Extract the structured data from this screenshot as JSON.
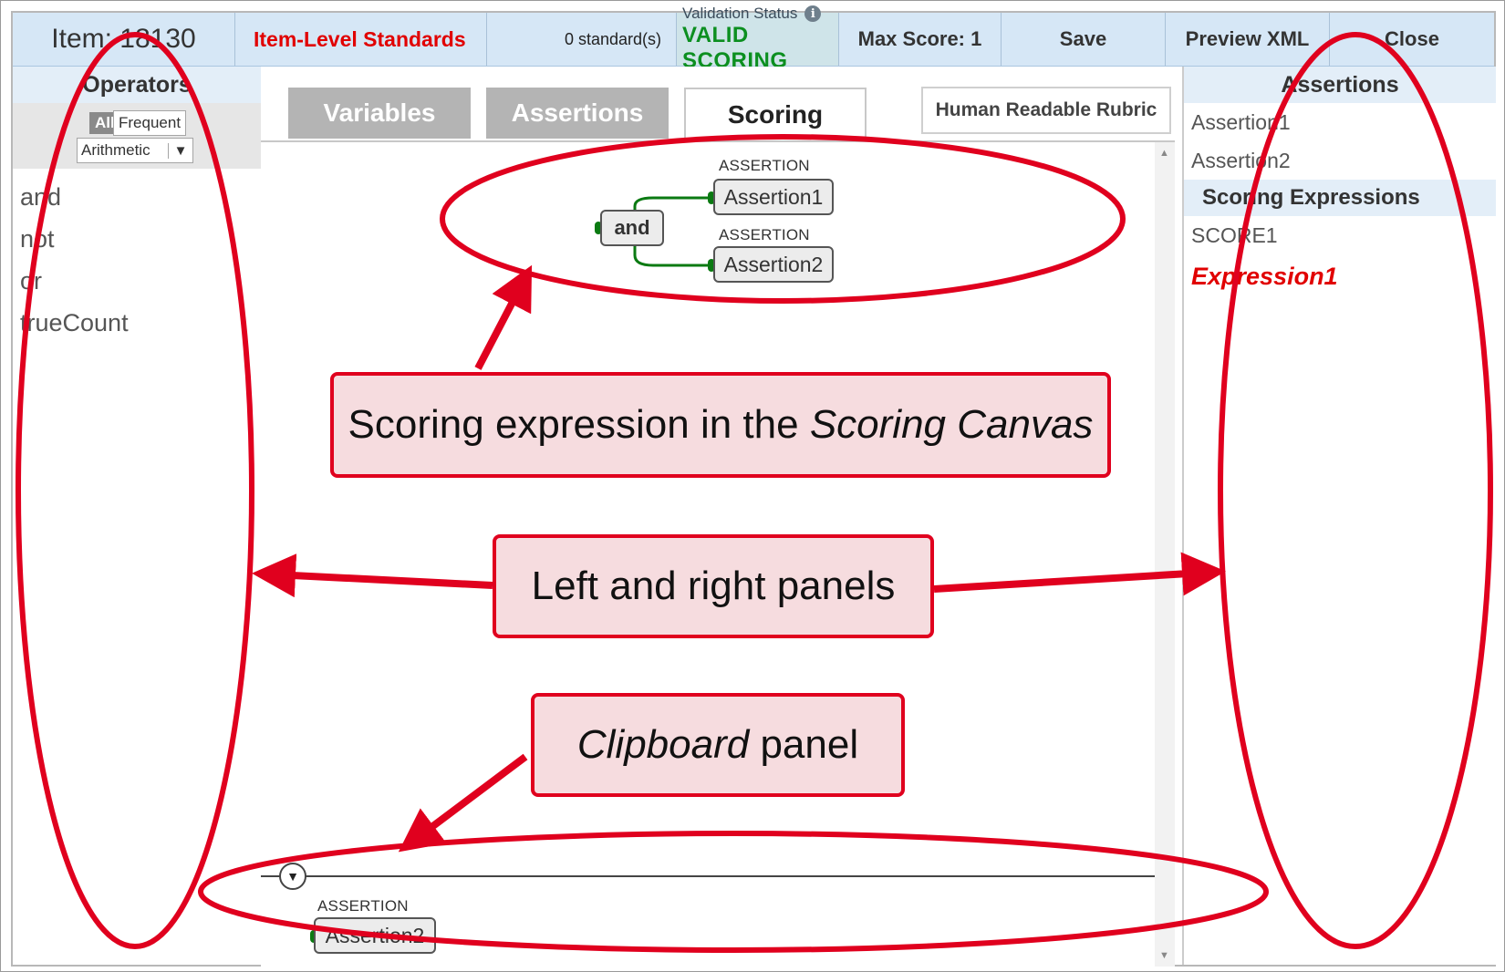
{
  "topbar": {
    "item_label": "Item: 18130",
    "standards_label": "Item-Level Standards",
    "standards_count": "0 standard(s)",
    "validation_label": "Validation Status",
    "validation_value": "VALID SCORING",
    "max_score": "Max Score: 1",
    "save": "Save",
    "preview_xml": "Preview XML",
    "close": "Close"
  },
  "left_panel": {
    "title": "Operators",
    "filter_all": "All",
    "filter_frequent": "Frequent",
    "category_select": "Arithmetic",
    "operators": [
      "and",
      "not",
      "or",
      "trueCount"
    ]
  },
  "tabs": {
    "variables": "Variables",
    "assertions": "Assertions",
    "scoring": "Scoring",
    "rubric_button": "Human Readable Rubric"
  },
  "canvas": {
    "operator_node": "and",
    "node_type": "ASSERTION",
    "node_1": "Assertion1",
    "node_2": "Assertion2",
    "clipboard_type": "ASSERTION",
    "clipboard_node": "Assertion2"
  },
  "right_panel": {
    "title": "Assertions",
    "assertions": [
      "Assertion1",
      "Assertion2"
    ],
    "section_title": "Scoring Expressions",
    "score_item": "SCORE1",
    "expression_item": "Expression1"
  },
  "annotations": {
    "box1_prefix": "Scoring expression in the ",
    "box1_italic": "Scoring Canvas",
    "box2": "Left and right panels",
    "box3_italic": "Clipboard",
    "box3_suffix": " panel"
  },
  "colors": {
    "annotation_red": "#e0001e",
    "valid_green": "#0c8f20",
    "header_blue": "#d6e7f6"
  }
}
